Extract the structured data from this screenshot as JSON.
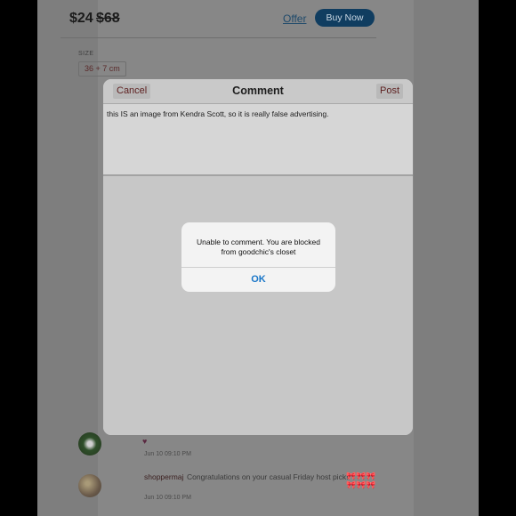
{
  "listing": {
    "price": "$24",
    "original_price": "$68",
    "offer_label": "Offer",
    "buy_now_label": "Buy Now",
    "size_label": "SIZE",
    "size_value": "36 + 7 cm"
  },
  "comment_modal": {
    "title": "Comment",
    "cancel_label": "Cancel",
    "post_label": "Post",
    "text": "this IS an image from Kendra Scott, so it is really false advertising."
  },
  "alert": {
    "message_line1": "Unable to comment. You are blocked",
    "message_line2": "from goodchic's closet",
    "ok_label": "OK"
  },
  "comments": [
    {
      "user": "",
      "text": "",
      "time": "Jun 10 09:10 PM",
      "emoji": "♥"
    },
    {
      "user": "shoppermaj",
      "text": "Congratulations on your casual Friday host pick!!",
      "emoji": "🎀🎀🎀🎀🎀🎀",
      "time": "Jun 10 09:10 PM"
    }
  ],
  "colors": {
    "accent": "#1976c8",
    "buy_button": "#103d60",
    "overlay": "#858585"
  }
}
